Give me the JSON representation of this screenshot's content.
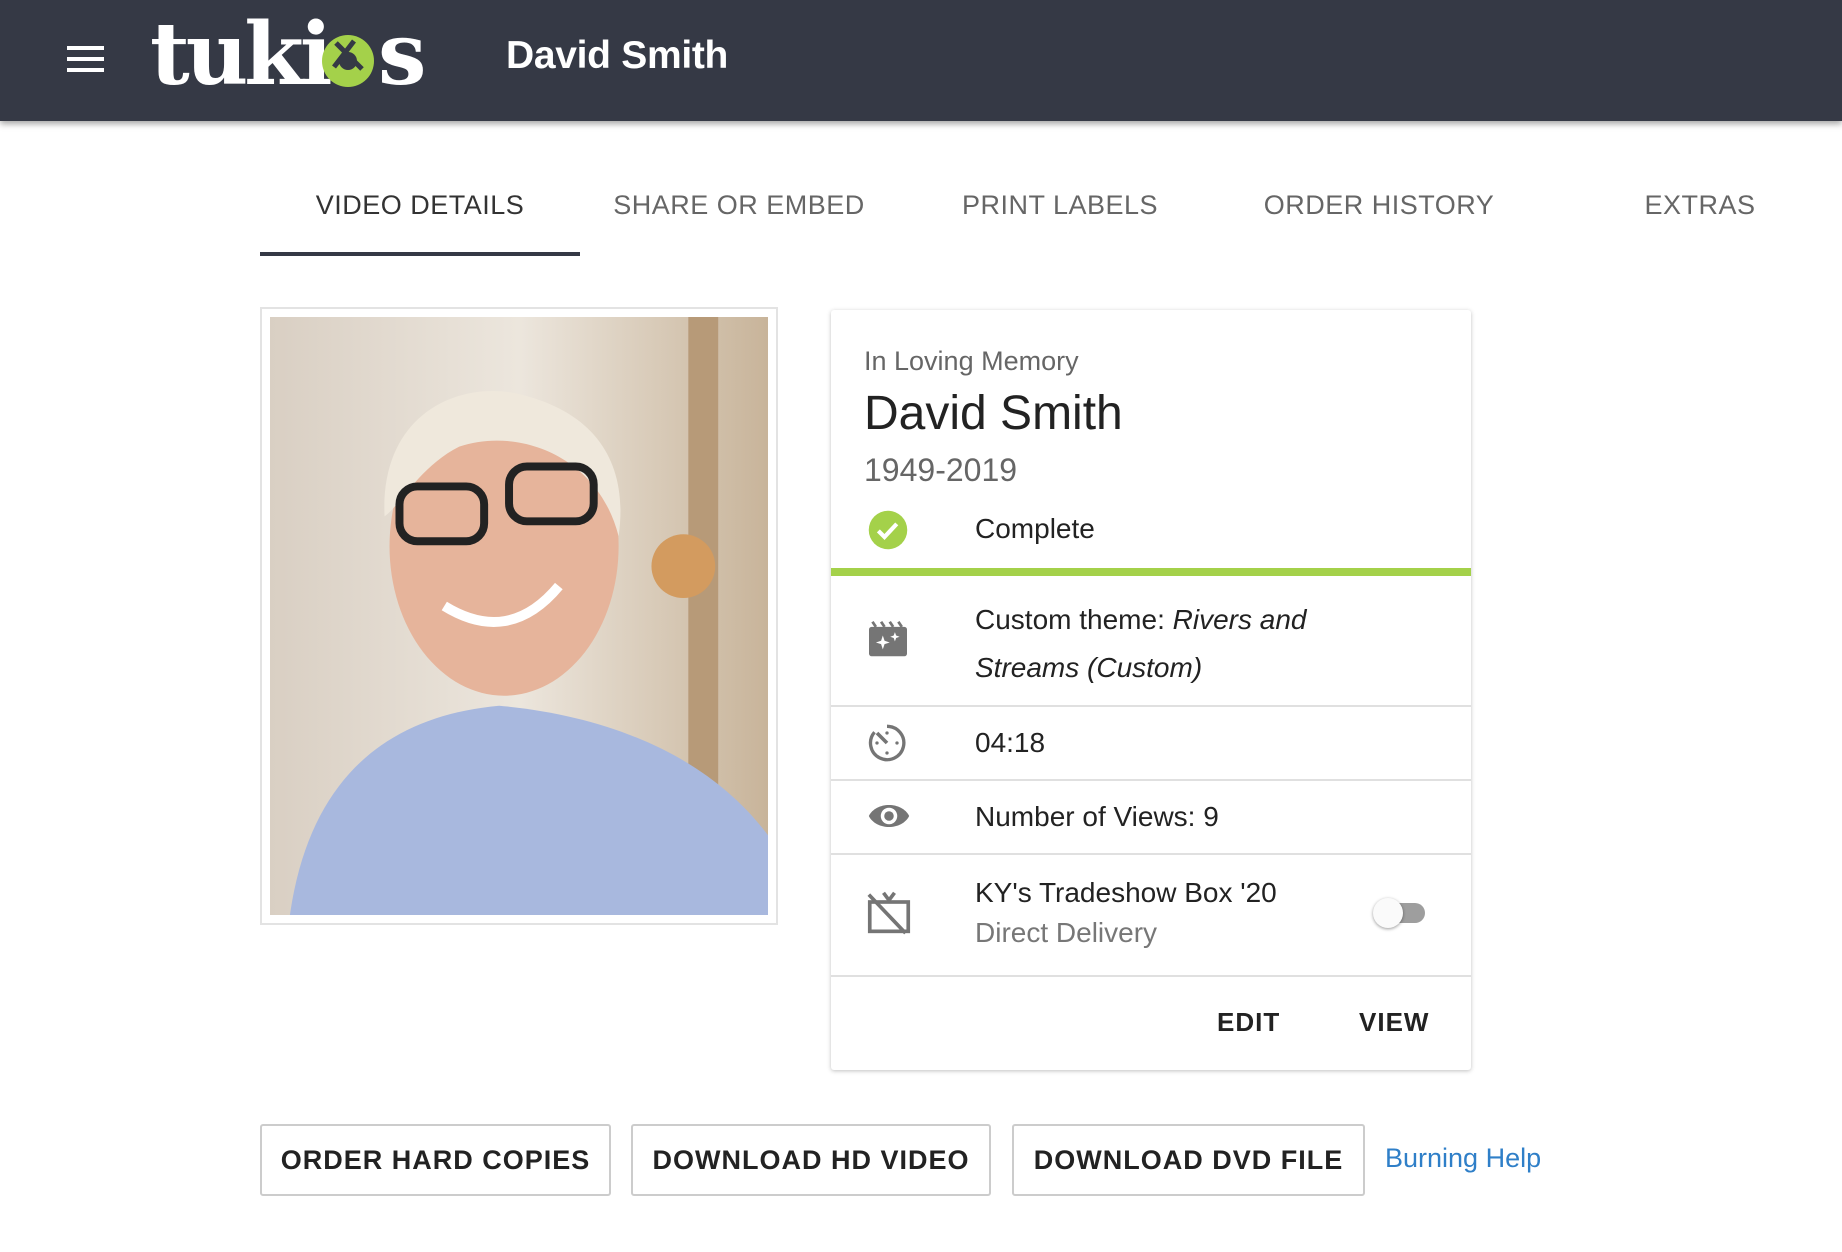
{
  "header": {
    "title": "David Smith",
    "logo_text": "tukios",
    "menu_icon": "hamburger-icon"
  },
  "tabs": [
    {
      "label": "VIDEO DETAILS",
      "active": true
    },
    {
      "label": "SHARE OR EMBED"
    },
    {
      "label": "PRINT LABELS"
    },
    {
      "label": "ORDER HISTORY"
    },
    {
      "label": "EXTRAS"
    }
  ],
  "card": {
    "kicker": "In Loving Memory",
    "name": "David Smith",
    "dates": "1949-2019",
    "status": "Complete",
    "progress_percent": 100,
    "theme_label": "Custom theme:",
    "theme_name": "Rivers and Streams (Custom)",
    "duration": "04:18",
    "views": "Number of Views: 9",
    "delivery_title": "KY's Tradeshow Box '20",
    "delivery_sub": "Direct Delivery",
    "delivery_enabled": false,
    "edit": "EDIT",
    "view": "VIEW"
  },
  "actions": {
    "order": "ORDER HARD COPIES",
    "hd": "DOWNLOAD HD VIDEO",
    "dvd": "DOWNLOAD DVD FILE",
    "help": "Burning Help"
  },
  "colors": {
    "header": "#353945",
    "accent": "#a4d14a",
    "link": "#2f7fc8"
  }
}
